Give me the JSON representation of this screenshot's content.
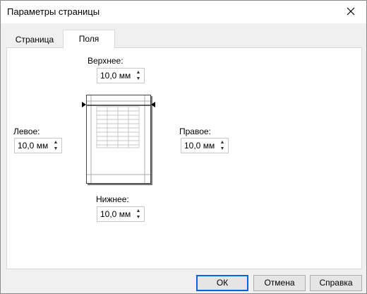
{
  "window": {
    "title": "Параметры страницы"
  },
  "tabs": [
    {
      "label": "Страница"
    },
    {
      "label": "Поля"
    }
  ],
  "margins": {
    "top": {
      "label": "Верхнее:",
      "value": "10,0 мм"
    },
    "left": {
      "label": "Левое:",
      "value": "10,0 мм"
    },
    "right": {
      "label": "Правое:",
      "value": "10,0 мм"
    },
    "bottom": {
      "label": "Нижнее:",
      "value": "10,0 мм"
    }
  },
  "buttons": {
    "ok": "ОК",
    "cancel": "Отмена",
    "help": "Справка"
  },
  "icons": {
    "close": "close-icon",
    "spin": "spin-arrows-icon",
    "preview": "page-preview-icon"
  }
}
